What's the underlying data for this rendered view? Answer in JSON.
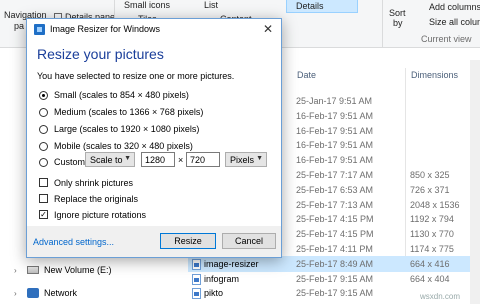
{
  "ribbon": {
    "navigation_pane": "Navigation",
    "navigation_pane_2": "pa",
    "details_pane": "Details pane",
    "small_icons": "Small icons",
    "tiles": "Tiles",
    "list": "List",
    "content": "Content",
    "details": "Details",
    "sort_by": "Sort",
    "sort_by_2": "by",
    "add_columns": "Add columns",
    "size_all_columns": "Size all column",
    "current_view": "Current view"
  },
  "nav": {
    "new_volume": "New Volume (E:)",
    "network": "Network"
  },
  "columns": {
    "date": "Date",
    "dimensions": "Dimensions"
  },
  "files": [
    {
      "name": "",
      "date": "25-Jan-17 9:51 AM",
      "dim": ""
    },
    {
      "name": "",
      "date": "16-Feb-17 9:51 AM",
      "dim": ""
    },
    {
      "name": "",
      "date": "16-Feb-17 9:51 AM",
      "dim": ""
    },
    {
      "name": "",
      "date": "16-Feb-17 9:51 AM",
      "dim": ""
    },
    {
      "name": "",
      "date": "16-Feb-17 9:51 AM",
      "dim": ""
    },
    {
      "name": "",
      "date": "25-Feb-17 7:17 AM",
      "dim": "850 x 325"
    },
    {
      "name": "",
      "date": "25-Feb-17 6:53 AM",
      "dim": "726 x 371"
    },
    {
      "name": "",
      "date": "25-Feb-17 7:13 AM",
      "dim": "2048 x 1536"
    },
    {
      "name": "",
      "date": "25-Feb-17 4:15 PM",
      "dim": "1192 x 794"
    },
    {
      "name": "",
      "date": "25-Feb-17 4:15 PM",
      "dim": "1130 x 770"
    },
    {
      "name": "",
      "date": "25-Feb-17 4:11 PM",
      "dim": "1174 x 775"
    },
    {
      "name": "image-resizer",
      "date": "25-Feb-17 8:49 AM",
      "dim": "664 x 416"
    },
    {
      "name": "infogram",
      "date": "25-Feb-17 9:15 AM",
      "dim": "664 x 404"
    },
    {
      "name": "pikto",
      "date": "25-Feb-17 9:15 AM",
      "dim": ""
    }
  ],
  "dialog": {
    "title": "Image Resizer for Windows",
    "close": "✕",
    "heading": "Resize your pictures",
    "subtext": "You have selected to resize one or more pictures.",
    "options": [
      {
        "label": "Small (scales to 854 × 480 pixels)",
        "checked": true
      },
      {
        "label": "Medium (scales to 1366 × 768 pixels)",
        "checked": false
      },
      {
        "label": "Large (scales to 1920 × 1080 pixels)",
        "checked": false
      },
      {
        "label": "Mobile (scales to 320 × 480 pixels)",
        "checked": false
      },
      {
        "label": "Custom:",
        "checked": false
      }
    ],
    "custom": {
      "mode": "Scale to",
      "width": "1280",
      "times": "×",
      "height": "720",
      "unit": "Pixels"
    },
    "checkboxes": [
      {
        "label": "Only shrink pictures",
        "checked": false
      },
      {
        "label": "Replace the originals",
        "checked": false
      },
      {
        "label": "Ignore picture rotations",
        "checked": true
      }
    ],
    "advanced": "Advanced settings...",
    "resize_button": "Resize",
    "cancel_button": "Cancel"
  },
  "colors": {
    "accent": "#0078d7",
    "heading": "#1a3e9a",
    "selection": "#cce8ff"
  },
  "watermark": "wsxdn.com"
}
